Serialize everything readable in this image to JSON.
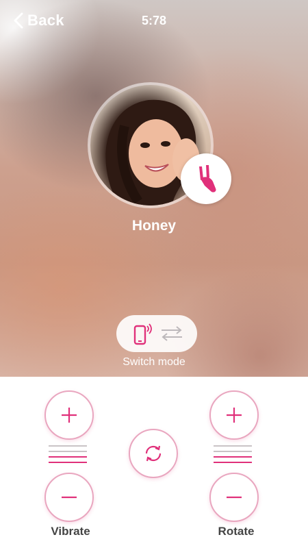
{
  "header": {
    "back_label": "Back",
    "time": "5:78"
  },
  "profile": {
    "name": "Honey"
  },
  "mode": {
    "switch_label": "Switch mode"
  },
  "controls": {
    "vibrate": {
      "label": "Vibrate",
      "level_lines": 4,
      "active_lines": 2
    },
    "rotate": {
      "label": "Rotate",
      "level_lines": 4,
      "active_lines": 2
    }
  },
  "colors": {
    "accent": "#e0307a",
    "button_border": "#e9a6bf",
    "inactive_line": "#c9c3c6"
  },
  "icons": {
    "back": "chevron-left-icon",
    "toy": "rabbit-vibrator-icon",
    "phone": "phone-signal-icon",
    "swap": "swap-arrows-icon",
    "plus": "plus-icon",
    "minus": "minus-icon",
    "sync": "refresh-icon"
  }
}
